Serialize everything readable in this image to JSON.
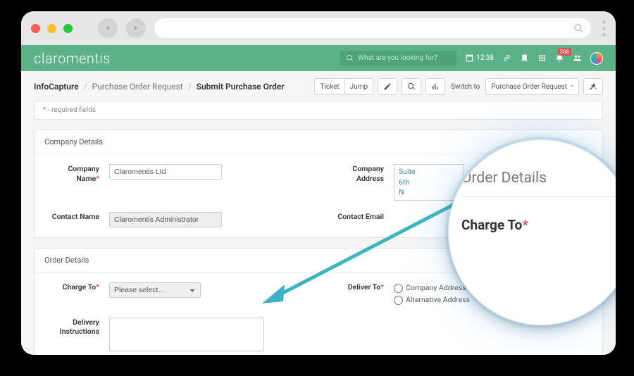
{
  "nav": {
    "logo": "claromentis",
    "search_placeholder": "What are you looking for?",
    "time": "12:38",
    "badge": "366"
  },
  "breadcrumbs": {
    "root": "InfoCapture",
    "mid": "Purchase Order Request",
    "leaf": "Submit Purchase Order"
  },
  "toolbar": {
    "ticket": "Ticket",
    "jump": "Jump",
    "switch_to": "Switch to",
    "project": "Purchase Order Request"
  },
  "required_note": {
    "ast": "*",
    "text": " - required fields"
  },
  "company_details": {
    "heading": "Company Details",
    "company_name_label": "Company Name",
    "company_name_value": "Claromentis Ltd",
    "company_address_label": "Company Address",
    "company_address_value": "Suite\n6th\nN",
    "contact_name_label": "Contact Name",
    "contact_name_value": "Claromentis Administrator",
    "contact_email_label": "Contact Email"
  },
  "order_details": {
    "heading": "Order Details",
    "charge_to_label": "Charge To",
    "charge_to_placeholder": "Please select...",
    "deliver_to_label": "Deliver To",
    "deliver_opt1": "Company Address",
    "deliver_opt2": "Alternative Address",
    "delivery_instructions_label": "Delivery Instructions"
  },
  "magnifier": {
    "title": "Order Details",
    "field": "Charge To",
    "ast": "*"
  },
  "ast": "*"
}
